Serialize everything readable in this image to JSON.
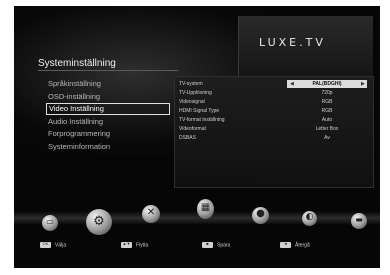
{
  "logo": {
    "brand": "LUXE.TV",
    "tagline": ""
  },
  "menu": {
    "title": "Systeminställning",
    "items": [
      {
        "label": "Språkinställning"
      },
      {
        "label": "OSD-inställning"
      },
      {
        "label": "Video Inställning",
        "active": true
      },
      {
        "label": "Audio Inställning"
      },
      {
        "label": "Forprogrammering"
      },
      {
        "label": "Systeminformation"
      }
    ]
  },
  "settings": {
    "rows": [
      {
        "label": "TV-system",
        "value": "PAL(BDGHI)",
        "selected": true
      },
      {
        "label": "TV-Upplösning",
        "value": "720p"
      },
      {
        "label": "Videosignal",
        "value": "RGB"
      },
      {
        "label": "HDMI Signal Type",
        "value": "RGB"
      },
      {
        "label": "TV-format inställning",
        "value": "Auto"
      },
      {
        "label": "Videoformat",
        "value": "Letter Box"
      },
      {
        "label": "DSBAS",
        "value": "Av"
      }
    ]
  },
  "footer": {
    "hints": [
      {
        "key": "icon-ok",
        "label": "Välja"
      },
      {
        "key": "icon-arrows",
        "label": "Flytta"
      },
      {
        "key": "icon-save",
        "label": "Spara"
      },
      {
        "key": "icon-back",
        "label": "Återgå"
      }
    ]
  },
  "colors": {
    "background": "#060606",
    "highlight": "#dcdcdc",
    "text": "#cfcfcf"
  }
}
